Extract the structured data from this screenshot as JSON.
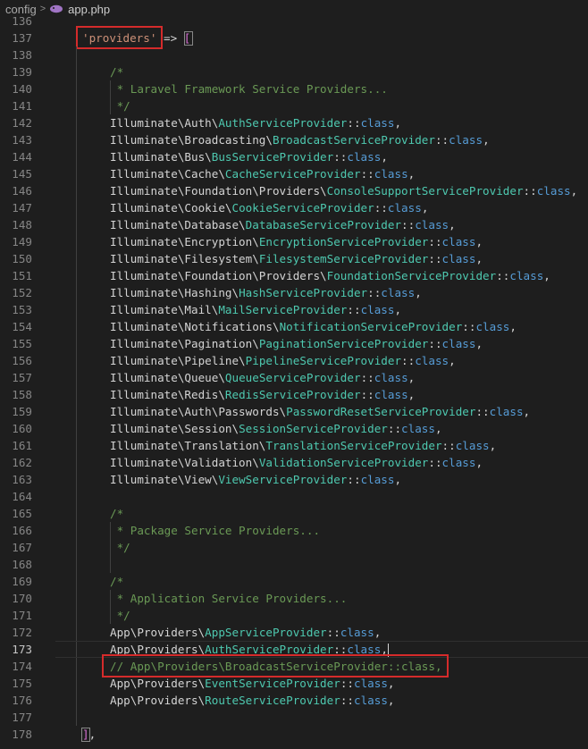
{
  "breadcrumb": {
    "folder": "config",
    "file": "app.php"
  },
  "colors": {
    "comment": "#6a9955",
    "string": "#ce9178",
    "class": "#4ec9b0",
    "keyword": "#569cd6",
    "highlight_box": "#d52b2b"
  },
  "current_line": 173,
  "lines": [
    {
      "n": "136",
      "t": "blank"
    },
    {
      "n": "137",
      "t": "key",
      "key": "'providers'",
      "arrow": " => ",
      "bracket": "["
    },
    {
      "n": "138",
      "t": "blank"
    },
    {
      "n": "139",
      "t": "comment",
      "text": "/*"
    },
    {
      "n": "140",
      "t": "comment",
      "text": " * Laravel Framework Service Providers..."
    },
    {
      "n": "141",
      "t": "comment",
      "text": " */"
    },
    {
      "n": "142",
      "t": "provider",
      "ns": "Illuminate\\Auth\\",
      "cls": "AuthServiceProvider"
    },
    {
      "n": "143",
      "t": "provider",
      "ns": "Illuminate\\Broadcasting\\",
      "cls": "BroadcastServiceProvider"
    },
    {
      "n": "144",
      "t": "provider",
      "ns": "Illuminate\\Bus\\",
      "cls": "BusServiceProvider"
    },
    {
      "n": "145",
      "t": "provider",
      "ns": "Illuminate\\Cache\\",
      "cls": "CacheServiceProvider"
    },
    {
      "n": "146",
      "t": "provider",
      "ns": "Illuminate\\Foundation\\Providers\\",
      "cls": "ConsoleSupportServiceProvider"
    },
    {
      "n": "147",
      "t": "provider",
      "ns": "Illuminate\\Cookie\\",
      "cls": "CookieServiceProvider"
    },
    {
      "n": "148",
      "t": "provider",
      "ns": "Illuminate\\Database\\",
      "cls": "DatabaseServiceProvider"
    },
    {
      "n": "149",
      "t": "provider",
      "ns": "Illuminate\\Encryption\\",
      "cls": "EncryptionServiceProvider"
    },
    {
      "n": "150",
      "t": "provider",
      "ns": "Illuminate\\Filesystem\\",
      "cls": "FilesystemServiceProvider"
    },
    {
      "n": "151",
      "t": "provider",
      "ns": "Illuminate\\Foundation\\Providers\\",
      "cls": "FoundationServiceProvider"
    },
    {
      "n": "152",
      "t": "provider",
      "ns": "Illuminate\\Hashing\\",
      "cls": "HashServiceProvider"
    },
    {
      "n": "153",
      "t": "provider",
      "ns": "Illuminate\\Mail\\",
      "cls": "MailServiceProvider"
    },
    {
      "n": "154",
      "t": "provider",
      "ns": "Illuminate\\Notifications\\",
      "cls": "NotificationServiceProvider"
    },
    {
      "n": "155",
      "t": "provider",
      "ns": "Illuminate\\Pagination\\",
      "cls": "PaginationServiceProvider"
    },
    {
      "n": "156",
      "t": "provider",
      "ns": "Illuminate\\Pipeline\\",
      "cls": "PipelineServiceProvider"
    },
    {
      "n": "157",
      "t": "provider",
      "ns": "Illuminate\\Queue\\",
      "cls": "QueueServiceProvider"
    },
    {
      "n": "158",
      "t": "provider",
      "ns": "Illuminate\\Redis\\",
      "cls": "RedisServiceProvider"
    },
    {
      "n": "159",
      "t": "provider",
      "ns": "Illuminate\\Auth\\Passwords\\",
      "cls": "PasswordResetServiceProvider"
    },
    {
      "n": "160",
      "t": "provider",
      "ns": "Illuminate\\Session\\",
      "cls": "SessionServiceProvider"
    },
    {
      "n": "161",
      "t": "provider",
      "ns": "Illuminate\\Translation\\",
      "cls": "TranslationServiceProvider"
    },
    {
      "n": "162",
      "t": "provider",
      "ns": "Illuminate\\Validation\\",
      "cls": "ValidationServiceProvider"
    },
    {
      "n": "163",
      "t": "provider",
      "ns": "Illuminate\\View\\",
      "cls": "ViewServiceProvider"
    },
    {
      "n": "164",
      "t": "blank"
    },
    {
      "n": "165",
      "t": "comment",
      "text": "/*"
    },
    {
      "n": "166",
      "t": "comment",
      "text": " * Package Service Providers..."
    },
    {
      "n": "167",
      "t": "comment",
      "text": " */"
    },
    {
      "n": "168",
      "t": "blank"
    },
    {
      "n": "169",
      "t": "comment",
      "text": "/*"
    },
    {
      "n": "170",
      "t": "comment",
      "text": " * Application Service Providers..."
    },
    {
      "n": "171",
      "t": "comment",
      "text": " */"
    },
    {
      "n": "172",
      "t": "provider",
      "ns": "App\\Providers\\",
      "cls": "AppServiceProvider"
    },
    {
      "n": "173",
      "t": "provider",
      "ns": "App\\Providers\\",
      "cls": "AuthServiceProvider"
    },
    {
      "n": "174",
      "t": "commented",
      "text": "// App\\Providers\\BroadcastServiceProvider::class,"
    },
    {
      "n": "175",
      "t": "provider",
      "ns": "App\\Providers\\",
      "cls": "EventServiceProvider"
    },
    {
      "n": "176",
      "t": "provider",
      "ns": "App\\Providers\\",
      "cls": "RouteServiceProvider"
    },
    {
      "n": "177",
      "t": "blank"
    },
    {
      "n": "178",
      "t": "close",
      "bracket": "]",
      "tail": ","
    }
  ],
  "tokens": {
    "sep": "::",
    "kw": "class",
    "comma": ","
  }
}
